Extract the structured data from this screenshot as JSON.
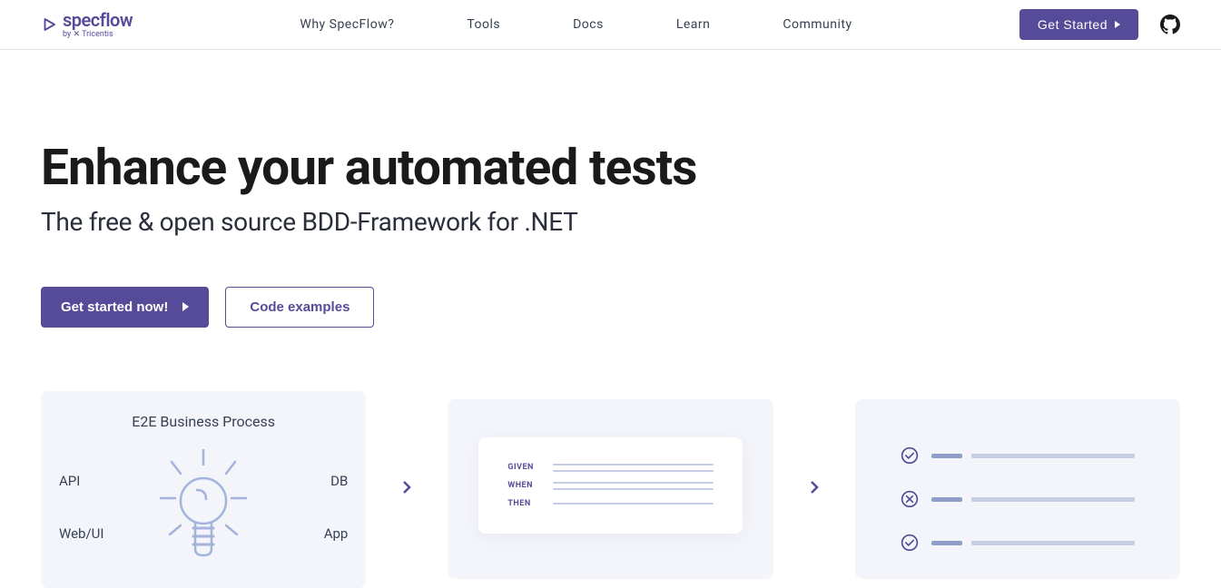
{
  "logo": {
    "main": "specflow",
    "sub": "by ✕ Tricentis"
  },
  "nav": {
    "why": "Why SpecFlow?",
    "tools": "Tools",
    "docs": "Docs",
    "learn": "Learn",
    "community": "Community"
  },
  "header": {
    "cta": "Get Started"
  },
  "hero": {
    "title": "Enhance your automated tests",
    "subtitle": "The free & open source BDD-Framework for .NET",
    "primary_btn": "Get started now!",
    "secondary_btn": "Code examples"
  },
  "card1": {
    "title": "E2E Business Process",
    "api": "API",
    "webui": "Web/UI",
    "db": "DB",
    "app": "App"
  },
  "card2": {
    "given": "GIVEN",
    "when": "WHEN",
    "then": "THEN"
  }
}
